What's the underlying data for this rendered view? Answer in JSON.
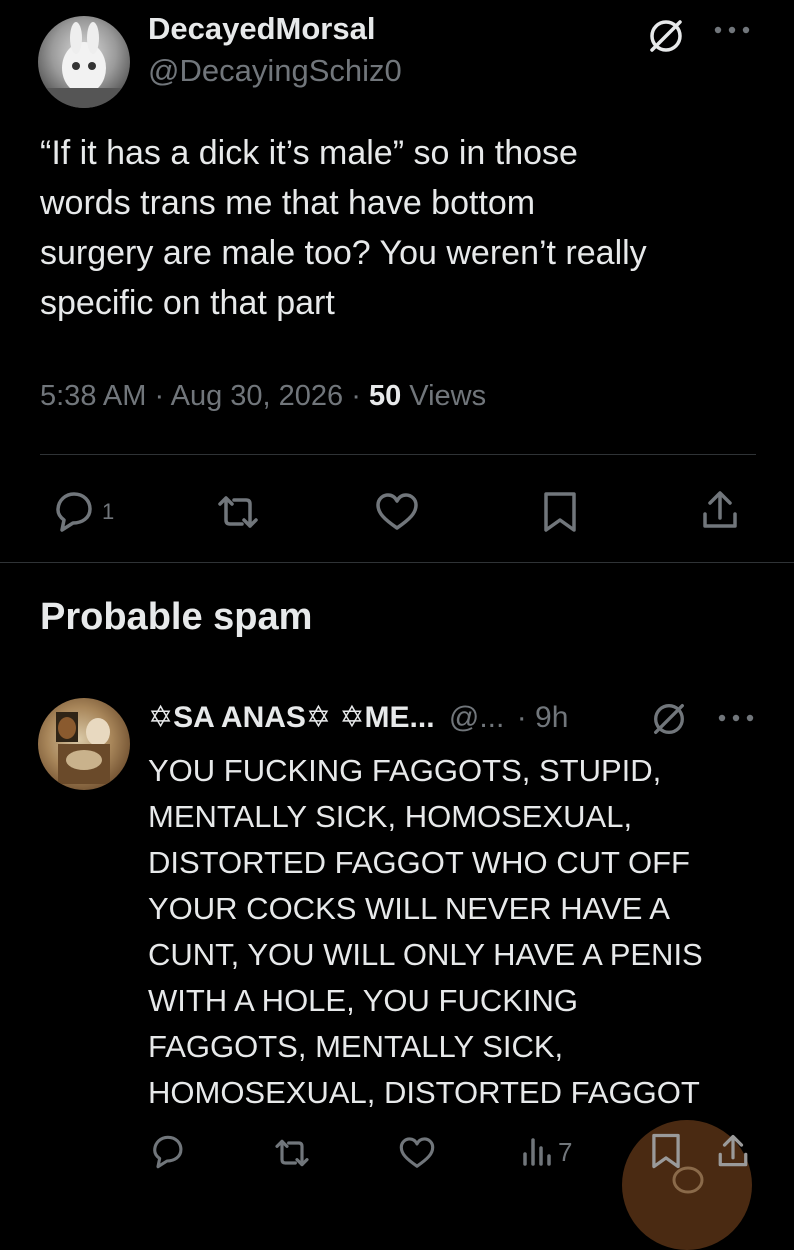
{
  "main_tweet": {
    "display_name": "DecayedMorsal",
    "handle": "@DecayingSchiz0",
    "text_lines": [
      "“If it has a dick it’s male” so in those",
      "words trans me that have bottom",
      "surgery are male too? You weren’t really",
      "specific on that part"
    ],
    "time": "5:38 AM",
    "sep": "·",
    "date": "Aug 30, 2026",
    "views_count": "50",
    "views_label": "Views",
    "actions": {
      "reply_count": "1"
    }
  },
  "section": {
    "title": "Probable spam"
  },
  "reply": {
    "display_name": "✡SA ANAS✡ ✡ME...",
    "handle": "@...",
    "age": "· 9h",
    "text_lines": [
      "YOU FUCKING FAGGOTS, STUPID,",
      "MENTALLY SICK, HOMOSEXUAL,",
      "DISTORTED FAGGOT WHO CUT OFF",
      "YOUR COCKS WILL NEVER HAVE A",
      "CUNT, YOU WILL ONLY HAVE A PENIS",
      "WITH A HOLE, YOU FUCKING",
      "FAGGOTS, MENTALLY SICK,",
      "HOMOSEXUAL, DISTORTED FAGGOT"
    ],
    "actions": {
      "views_count": "7"
    }
  },
  "icons": [
    "no-entry-icon",
    "more-icon",
    "reply-icon",
    "retweet-icon",
    "like-icon",
    "bookmark-icon",
    "share-icon",
    "views-icon"
  ],
  "colors": {
    "background": "#000000",
    "text": "#e7e9ea",
    "muted": "#71767b",
    "divider": "#2f3336",
    "overlay_circle": "#4a2a12"
  }
}
